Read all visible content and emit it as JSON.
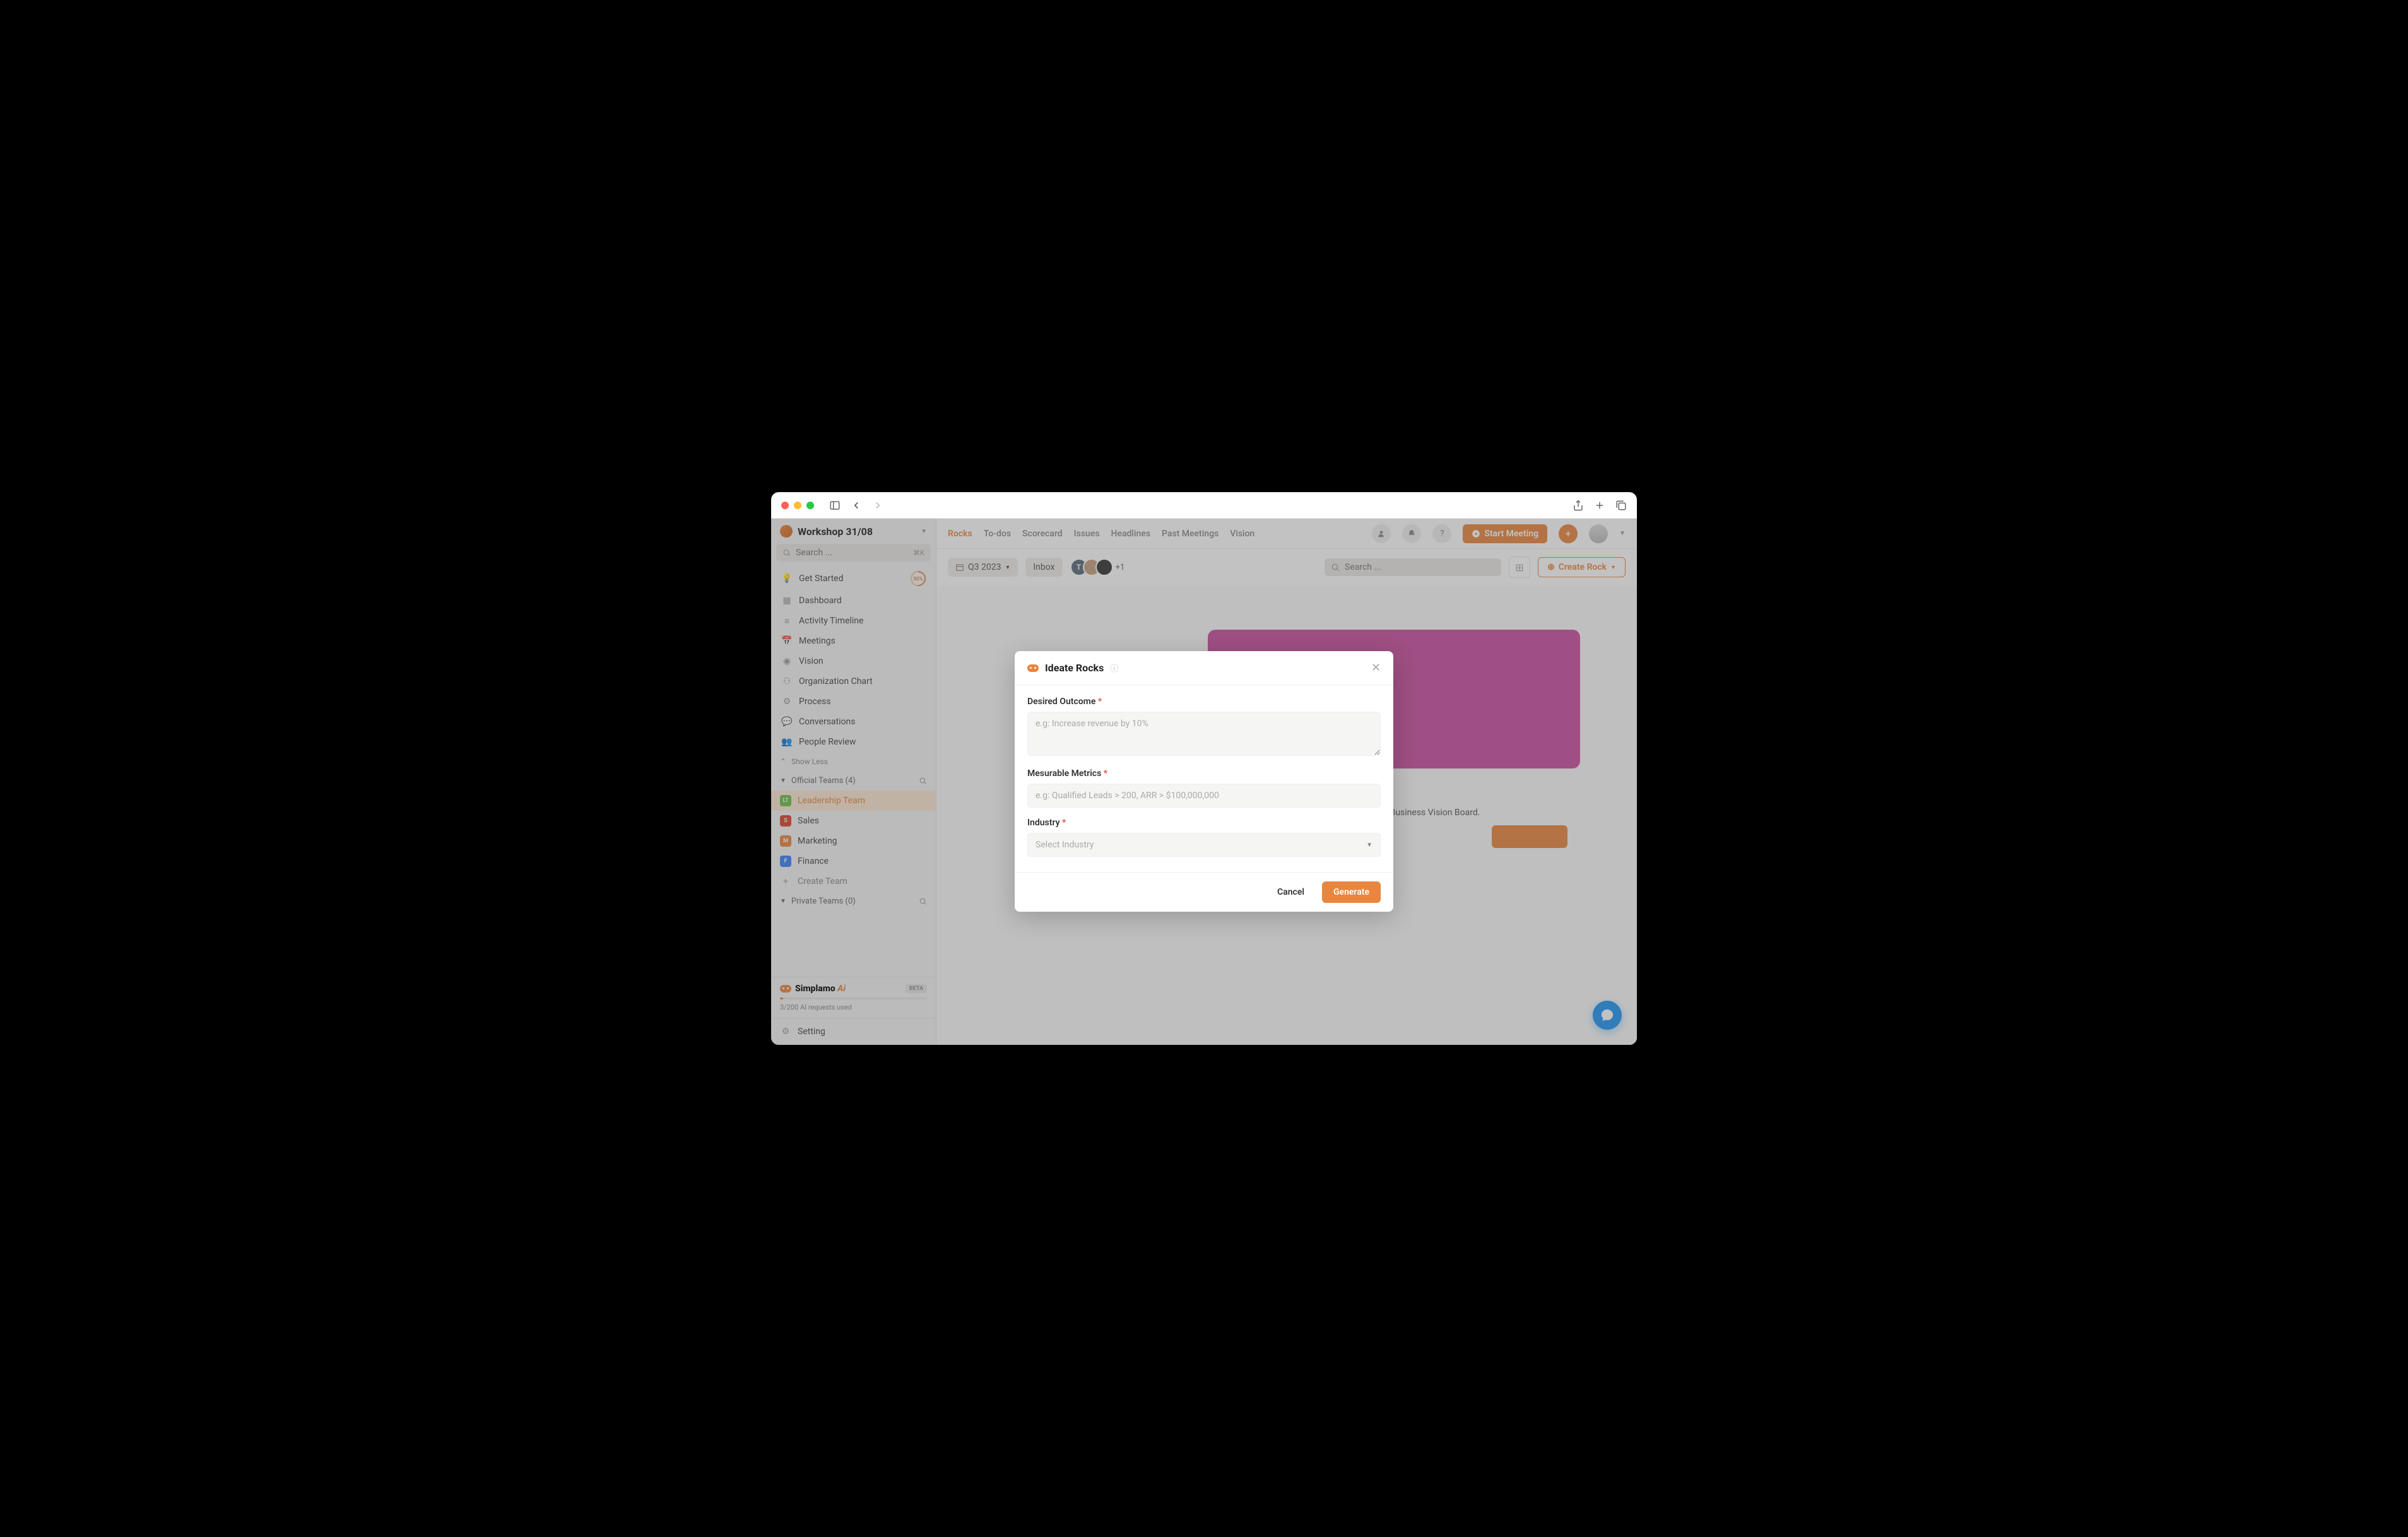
{
  "workspace": {
    "title": "Workshop 31/08"
  },
  "sidebar": {
    "search_placeholder": "Search ...",
    "search_kbd": "⌘K",
    "nav": [
      {
        "label": "Get Started",
        "progress": "50%"
      },
      {
        "label": "Dashboard"
      },
      {
        "label": "Activity Timeline"
      },
      {
        "label": "Meetings"
      },
      {
        "label": "Vision"
      },
      {
        "label": "Organization Chart"
      },
      {
        "label": "Process"
      },
      {
        "label": "Conversations"
      },
      {
        "label": "People Review"
      }
    ],
    "show_less": "Show Less",
    "official_teams_label": "Official Teams (4)",
    "teams": [
      {
        "badge": "LT",
        "color": "#6abf4b",
        "label": "Leadership Team",
        "active": true
      },
      {
        "badge": "S",
        "color": "#d9452b",
        "label": "Sales"
      },
      {
        "badge": "M",
        "color": "#e8863f",
        "label": "Marketing"
      },
      {
        "badge": "F",
        "color": "#3b82f6",
        "label": "Finance"
      }
    ],
    "create_team": "Create Team",
    "private_teams_label": "Private Teams (0)",
    "ai": {
      "name": "Simplamo",
      "suffix": "Ai",
      "beta": "BETA",
      "usage": "3/200 AI requests used"
    },
    "setting": "Setting"
  },
  "topbar": {
    "tabs": [
      "Rocks",
      "To-dos",
      "Scorecard",
      "Issues",
      "Headlines",
      "Past Meetings",
      "Vision"
    ],
    "start_meeting": "Start Meeting"
  },
  "toolbar": {
    "period": "Q3 2023",
    "inbox": "Inbox",
    "avatar_initial": "T",
    "plus_n": "+1",
    "search_placeholder": "Search ...",
    "create_rock": "Create Rock"
  },
  "bg": {
    "text": "he Business Vision Board."
  },
  "modal": {
    "title": "Ideate Rocks",
    "fields": {
      "outcome": {
        "label": "Desired Outcome",
        "placeholder": "e.g: Increase revenue by 10%"
      },
      "metrics": {
        "label": "Mesurable Metrics",
        "placeholder": "e.g: Qualified Leads > 200, ARR > $100,000,000"
      },
      "industry": {
        "label": "Industry",
        "placeholder": "Select Industry"
      }
    },
    "cancel": "Cancel",
    "generate": "Generate"
  }
}
